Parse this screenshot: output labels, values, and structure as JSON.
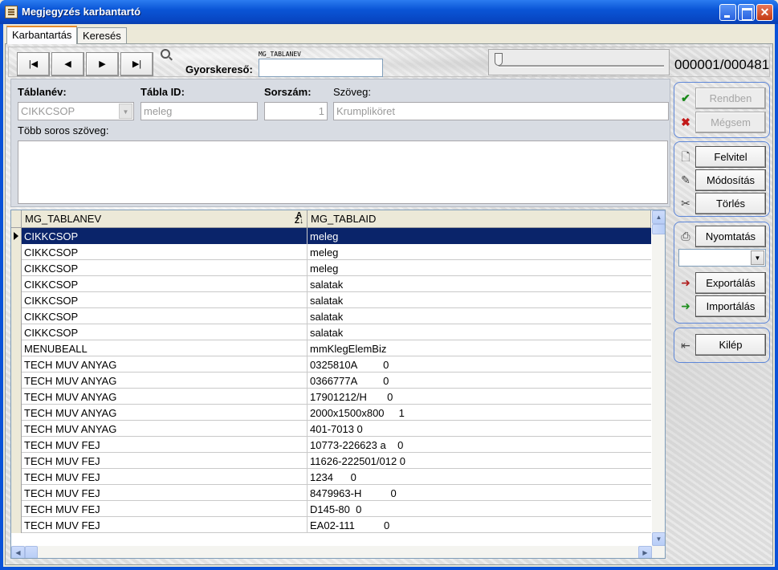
{
  "window": {
    "title": "Megjegyzés karbantartó"
  },
  "tabs": [
    {
      "label": "Karbantartás",
      "active": true
    },
    {
      "label": "Keresés",
      "active": false
    }
  ],
  "toolbar": {
    "nav": {
      "first": "first-record",
      "prev": "prev-record",
      "next": "next-record",
      "last": "last-record"
    },
    "quick_search": {
      "caption": "MG_TABLANEV",
      "label": "Gyorskereső:",
      "value": ""
    },
    "record_counter": "000001/000481",
    "slider_position": 0
  },
  "form": {
    "tablanev": {
      "label": "Táblanév:",
      "value": "CIKKCSOP"
    },
    "tabla_id": {
      "label": "Tábla ID:",
      "value": "meleg"
    },
    "sorszam": {
      "label": "Sorszám:",
      "value": "1"
    },
    "szoveg": {
      "label": "Szöveg:",
      "value": "Krumpliköret"
    },
    "tobb_soros": {
      "label": "Több soros szöveg:",
      "value": ""
    }
  },
  "grid": {
    "columns": [
      "MG_TABLANEV",
      "MG_TABLAID"
    ],
    "rows": [
      [
        "CIKKCSOP",
        "meleg"
      ],
      [
        "CIKKCSOP",
        "meleg"
      ],
      [
        "CIKKCSOP",
        "meleg"
      ],
      [
        "CIKKCSOP",
        "salatak"
      ],
      [
        "CIKKCSOP",
        "salatak"
      ],
      [
        "CIKKCSOP",
        "salatak"
      ],
      [
        "CIKKCSOP",
        "salatak"
      ],
      [
        "MENUBEALL",
        "mmKlegElemBiz"
      ],
      [
        "TECH MUV ANYAG",
        "0325810A         0"
      ],
      [
        "TECH MUV ANYAG",
        "0366777A         0"
      ],
      [
        "TECH MUV ANYAG",
        "17901212/H       0"
      ],
      [
        "TECH MUV ANYAG",
        "2000x1500x800     1"
      ],
      [
        "TECH MUV ANYAG",
        "401-7013 0"
      ],
      [
        "TECH MUV FEJ",
        "10773-226623 a    0"
      ],
      [
        "TECH MUV FEJ",
        "11626-222501/012 0"
      ],
      [
        "TECH MUV FEJ",
        "1234      0"
      ],
      [
        "TECH MUV FEJ",
        "8479963-H          0"
      ],
      [
        "TECH MUV FEJ",
        "D145-80  0"
      ],
      [
        "TECH MUV FEJ",
        "EA02-111          0"
      ]
    ]
  },
  "side": {
    "ok": "Rendben",
    "cancel": "Mégsem",
    "add": "Felvitel",
    "edit": "Módosítás",
    "delete": "Törlés",
    "print": "Nyomtatás",
    "print_select_value": "",
    "export": "Exportálás",
    "import": "Importálás",
    "exit": "Kilép"
  }
}
